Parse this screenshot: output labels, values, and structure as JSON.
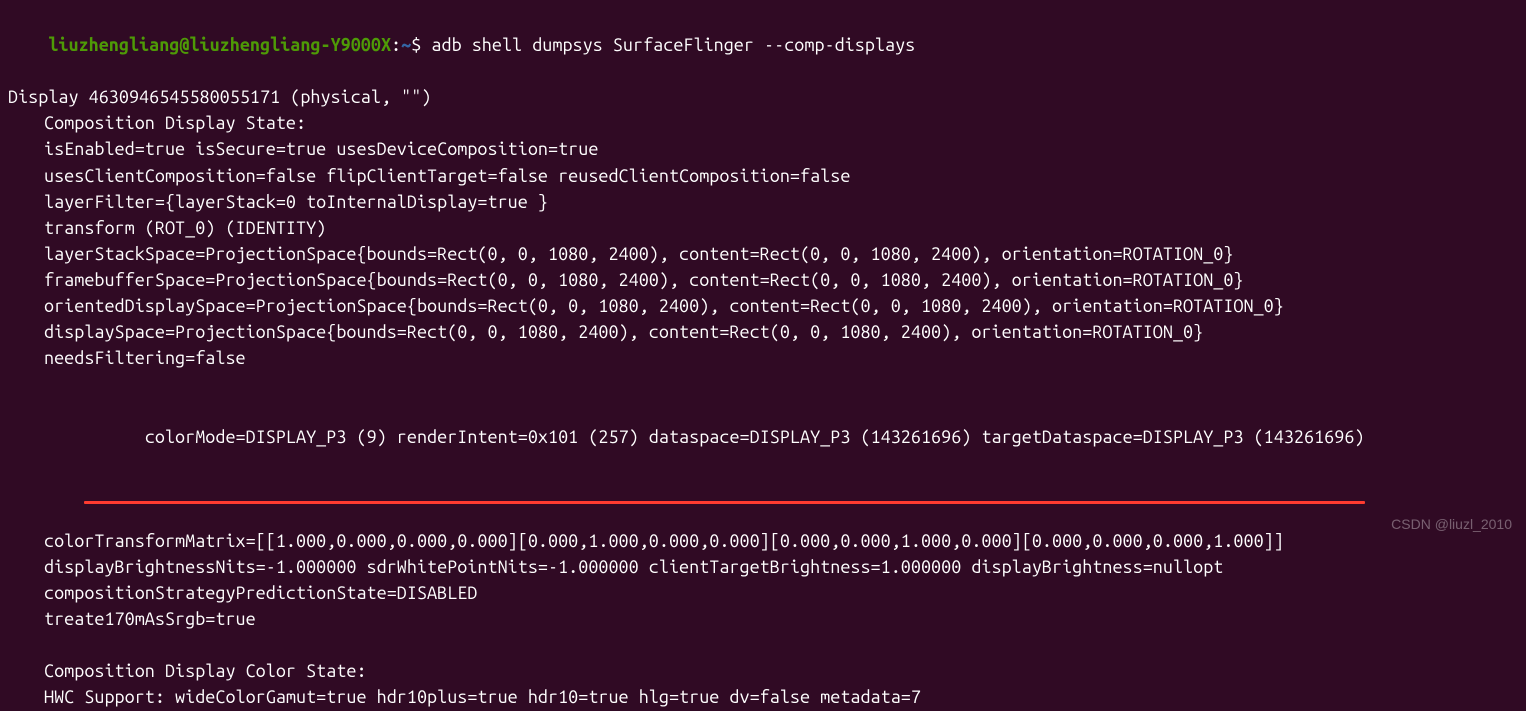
{
  "prompt": {
    "user": "liuzhengliang@liuzhengliang-Y9000X",
    "path": "~",
    "symbol": "$",
    "command": "adb shell dumpsys SurfaceFlinger --comp-displays"
  },
  "output": {
    "display_header": "Display 4630946545580055171 (physical, \"\")",
    "section1_title": "Composition Display State:",
    "l_enabled": "isEnabled=true isSecure=true usesDeviceComposition=true",
    "l_clientcomp": "usesClientComposition=false flipClientTarget=false reusedClientComposition=false",
    "l_layerfilter": "layerFilter={layerStack=0 toInternalDisplay=true }",
    "l_transform": "transform (ROT_0) (IDENTITY)",
    "l_layerstackspace": "layerStackSpace=ProjectionSpace{bounds=Rect(0, 0, 1080, 2400), content=Rect(0, 0, 1080, 2400), orientation=ROTATION_0}",
    "l_framebufferspace": "framebufferSpace=ProjectionSpace{bounds=Rect(0, 0, 1080, 2400), content=Rect(0, 0, 1080, 2400), orientation=ROTATION_0}",
    "l_orienteddisplayspace": "orientedDisplaySpace=ProjectionSpace{bounds=Rect(0, 0, 1080, 2400), content=Rect(0, 0, 1080, 2400), orientation=ROTATION_0}",
    "l_displayspace": "displaySpace=ProjectionSpace{bounds=Rect(0, 0, 1080, 2400), content=Rect(0, 0, 1080, 2400), orientation=ROTATION_0}",
    "l_needsfiltering": "needsFiltering=false",
    "l_colormode": "colorMode=DISPLAY_P3 (9) renderIntent=0x101 (257) dataspace=DISPLAY_P3 (143261696) targetDataspace=DISPLAY_P3 (143261696)",
    "l_colortransform": "colorTransformMatrix=[[1.000,0.000,0.000,0.000][0.000,1.000,0.000,0.000][0.000,0.000,1.000,0.000][0.000,0.000,0.000,1.000]]",
    "l_brightness": "displayBrightnessNits=-1.000000 sdrWhitePointNits=-1.000000 clientTargetBrightness=1.000000 displayBrightness=nullopt",
    "l_compstrategy": "compositionStrategyPredictionState=DISABLED",
    "l_treate170m": "treate170mAsSrgb=true",
    "section2_title": "Composition Display Color State:",
    "l_hwc": "HWC Support: wideColorGamut=true hdr10plus=true hdr10=true hlg=true dv=false metadata=7"
  },
  "watermark": "CSDN @liuzl_2010"
}
